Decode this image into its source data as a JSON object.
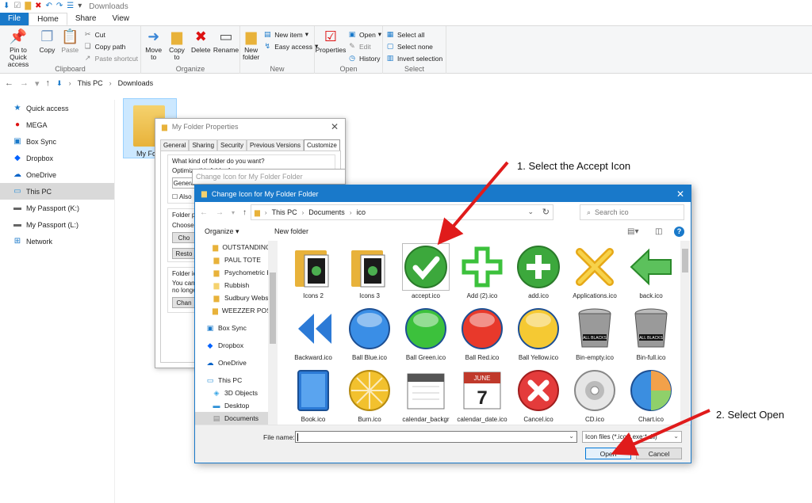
{
  "titlebar": {
    "title": "Downloads"
  },
  "ribbon": {
    "tabs": [
      "File",
      "Home",
      "Share",
      "View"
    ],
    "clipboard": {
      "name": "Clipboard",
      "pin": "Pin to Quick access",
      "copy": "Copy",
      "paste": "Paste",
      "cut": "Cut",
      "copy_path": "Copy path",
      "paste_shortcut": "Paste shortcut"
    },
    "organize": {
      "name": "Organize",
      "move_to": "Move to",
      "copy_to": "Copy to",
      "delete": "Delete",
      "rename": "Rename"
    },
    "new": {
      "name": "New",
      "new_folder": "New folder",
      "new_item": "New item",
      "easy_access": "Easy access"
    },
    "open": {
      "name": "Open",
      "properties": "Properties",
      "open": "Open",
      "edit": "Edit",
      "history": "History"
    },
    "select": {
      "name": "Select",
      "select_all": "Select all",
      "select_none": "Select none",
      "invert": "Invert selection"
    }
  },
  "address": {
    "parts": [
      "This PC",
      "Downloads"
    ]
  },
  "navpane": {
    "items": [
      {
        "label": "Quick access",
        "icon": "star-icon"
      },
      {
        "label": "MEGA",
        "icon": "mega-icon"
      },
      {
        "label": "Box Sync",
        "icon": "box-icon"
      },
      {
        "label": "Dropbox",
        "icon": "dropbox-icon"
      },
      {
        "label": "OneDrive",
        "icon": "cloud-icon"
      },
      {
        "label": "This PC",
        "icon": "computer-icon"
      },
      {
        "label": "My Passport (K:)",
        "icon": "drive-icon"
      },
      {
        "label": "My Passport (L:)",
        "icon": "drive-icon"
      },
      {
        "label": "Network",
        "icon": "network-icon"
      }
    ]
  },
  "folder": {
    "label": "My Fol"
  },
  "properties_dialog": {
    "title": "My Folder Properties",
    "tabs": [
      "General",
      "Sharing",
      "Security",
      "Previous Versions",
      "Customize"
    ],
    "active_tab": "Customize",
    "q1": "What kind of folder do you want?",
    "optimize": "Optimize this folder for:",
    "general": "Genera",
    "also": "Also",
    "folder_pictures": "Folder p",
    "choose": "Choose",
    "choose_btn": "Cho",
    "restore_btn": "Resto",
    "folder_icons": "Folder ic",
    "you_can": "You can",
    "no_longer": "no longe",
    "change_btn": "Chan"
  },
  "stub_dialog": {
    "title": "Change Icon for My Folder Folder"
  },
  "icon_dialog": {
    "title": "Change Icon for My Folder Folder",
    "breadcrumb": [
      "This PC",
      "Documents",
      "ico"
    ],
    "search_placeholder": "Search ico",
    "organize": "Organize",
    "new_folder": "New folder",
    "tree": [
      {
        "label": "OUTSTANDING T",
        "level": 1,
        "icon": "folder-sync-icon"
      },
      {
        "label": "PAUL TOTE",
        "level": 1,
        "icon": "folder-sync-icon"
      },
      {
        "label": "Psychometric b",
        "level": 1,
        "icon": "folder-sync-icon"
      },
      {
        "label": "Rubbish",
        "level": 1,
        "icon": "folder-icon"
      },
      {
        "label": "Sudbury Website",
        "level": 1,
        "icon": "folder-sync-icon"
      },
      {
        "label": "WEEZZER POSTS",
        "level": 1,
        "icon": "folder-sync-icon"
      },
      {
        "label": "",
        "level": 1,
        "icon": ""
      },
      {
        "label": "Box Sync",
        "level": 0,
        "icon": "box-icon"
      },
      {
        "label": "",
        "level": 0,
        "icon": ""
      },
      {
        "label": "Dropbox",
        "level": 0,
        "icon": "dropbox-icon"
      },
      {
        "label": "",
        "level": 0,
        "icon": ""
      },
      {
        "label": "OneDrive",
        "level": 0,
        "icon": "cloud-icon"
      },
      {
        "label": "",
        "level": 0,
        "icon": ""
      },
      {
        "label": "This PC",
        "level": 0,
        "icon": "computer-icon"
      },
      {
        "label": "3D Objects",
        "level": 2,
        "icon": "cube-icon"
      },
      {
        "label": "Desktop",
        "level": 2,
        "icon": "desktop-icon"
      },
      {
        "label": "Documents",
        "level": 2,
        "icon": "documents-icon"
      }
    ],
    "selected_tree": "Documents",
    "icons": [
      {
        "label": "Icons 2",
        "kind": "folder-doc"
      },
      {
        "label": "Icons 3",
        "kind": "folder-doc"
      },
      {
        "label": "accept.ico",
        "kind": "check"
      },
      {
        "label": "Add (2).ico",
        "kind": "plus-outline"
      },
      {
        "label": "add.ico",
        "kind": "plus-circle"
      },
      {
        "label": "Applications.ico",
        "kind": "tools"
      },
      {
        "label": "back.ico",
        "kind": "back-arrow"
      },
      {
        "label": "Backward.ico",
        "kind": "rewind"
      },
      {
        "label": "Ball Blue.ico",
        "kind": "ball",
        "color": "#3a8ee6"
      },
      {
        "label": "Ball Green.ico",
        "kind": "ball",
        "color": "#3cc13c"
      },
      {
        "label": "Ball Red.ico",
        "kind": "ball",
        "color": "#e8392b"
      },
      {
        "label": "Ball Yellow.ico",
        "kind": "ball",
        "color": "#f5c933"
      },
      {
        "label": "Bin-empty.ico",
        "kind": "bin"
      },
      {
        "label": "Bin-full.ico",
        "kind": "bin"
      },
      {
        "label": "Book.ico",
        "kind": "book"
      },
      {
        "label": "Burn.ico",
        "kind": "burn"
      },
      {
        "label": "calendar_backgr",
        "kind": "calendar-blank"
      },
      {
        "label": "calendar_date.ico",
        "kind": "calendar-date",
        "month": "JUNE",
        "day": "7"
      },
      {
        "label": "Cancel.ico",
        "kind": "cancel"
      },
      {
        "label": "CD.ico",
        "kind": "cd"
      },
      {
        "label": "Chart.ico",
        "kind": "pie"
      }
    ],
    "bin_text": "ALL BLACKS",
    "file_name_label": "File name:",
    "file_name_value": "",
    "file_type": "Icon files (*.ico;*.exe;*.dll)",
    "open": "Open",
    "cancel": "Cancel"
  },
  "annotations": {
    "step1": "1. Select the Accept Icon",
    "step2": "2. Select Open",
    "arrow_color": "#e01b1b"
  }
}
